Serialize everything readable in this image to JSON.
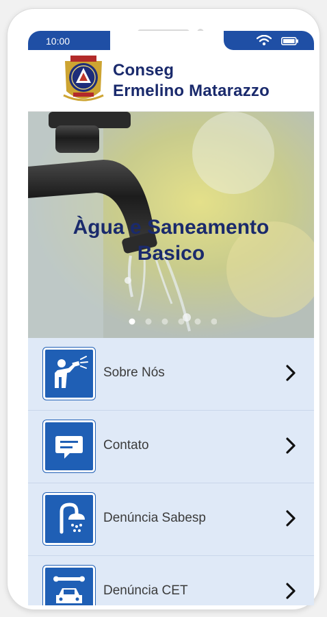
{
  "status_bar": {
    "time": "10:00",
    "wifi_icon": "wifi-icon",
    "battery_icon": "battery-icon"
  },
  "header": {
    "logo_icon": "conseg-badge-logo",
    "title_line1": "Conseg",
    "title_line2": "Ermelino Matarazzo"
  },
  "banner": {
    "caption_line1": "Àgua e Saneamento",
    "caption_line2": "Basico",
    "slide_count": 6,
    "active_slide": 1
  },
  "menu": {
    "items": [
      {
        "label": "Sobre Nós",
        "icon": "water-spray-person-icon"
      },
      {
        "label": "Contato",
        "icon": "chat-bubble-icon"
      },
      {
        "label": "Denúncia Sabesp",
        "icon": "shower-icon"
      },
      {
        "label": "Denúncia CET",
        "icon": "car-wrench-icon"
      }
    ]
  },
  "colors": {
    "brand_blue": "#1f4fa5",
    "title_navy": "#1a2a6c",
    "menu_background": "#dfe9f7",
    "icon_tile": "#1f5fb5"
  }
}
